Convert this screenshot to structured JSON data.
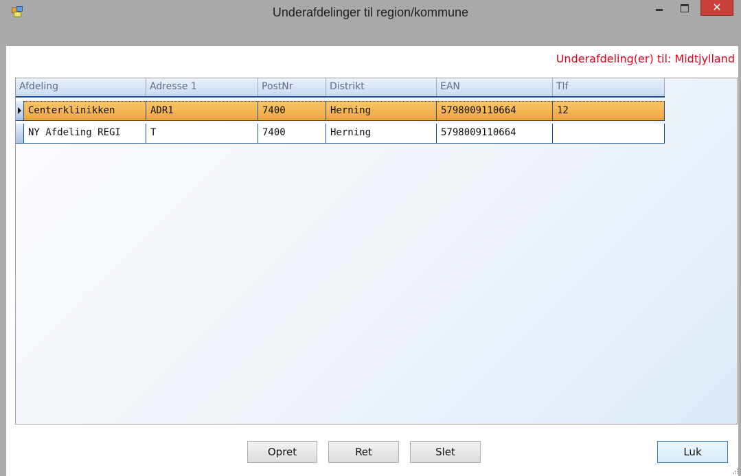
{
  "window": {
    "title": "Underafdelinger til region/kommune"
  },
  "header": {
    "subtitle": "Underafdeling(er) til: Midtjylland"
  },
  "grid": {
    "columns": [
      "Afdeling",
      "Adresse 1",
      "PostNr",
      "Distrikt",
      "EAN",
      "Tlf"
    ],
    "rows": [
      {
        "afdeling": "Centerklinikken",
        "adresse": "ADR1",
        "postnr": "7400",
        "distrikt": "Herning",
        "ean": "5798009110664",
        "tlf": "12",
        "selected": true
      },
      {
        "afdeling": "NY Afdeling REGI",
        "adresse": "T",
        "postnr": "7400",
        "distrikt": "Herning",
        "ean": "5798009110664",
        "tlf": "",
        "selected": false
      }
    ]
  },
  "buttons": {
    "opret": "Opret",
    "ret": "Ret",
    "slet": "Slet",
    "luk": "Luk"
  },
  "colors": {
    "accent": "#1d4f9a",
    "selection": "#f0a63a",
    "subtitle": "#e4001b",
    "close": "#c7413a"
  }
}
